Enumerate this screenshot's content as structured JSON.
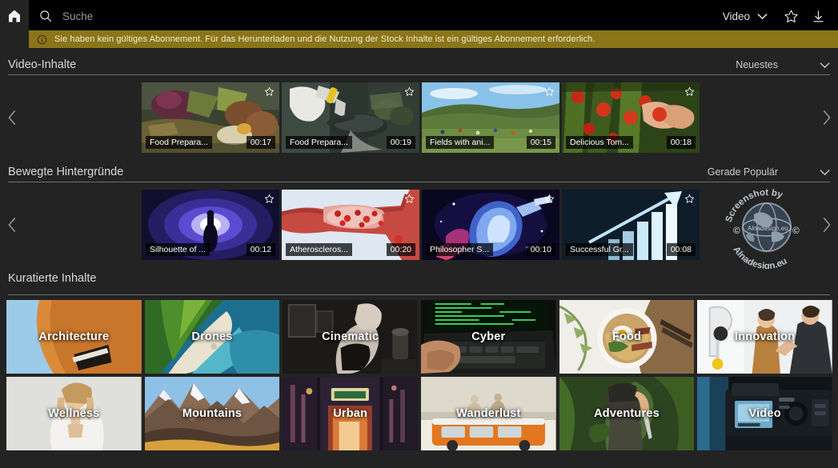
{
  "header": {
    "home_icon": "home-icon",
    "search_icon": "search-icon",
    "search_value": "",
    "search_placeholder": "Suche",
    "type_label": "Video",
    "chevron_icon": "chevron-down-icon",
    "favorites_icon": "star-icon",
    "download_icon": "download-icon"
  },
  "banner": {
    "info_icon": "info-icon",
    "text": "Sie haben kein gültiges Abonnement. Für das Herunterladen und die Nutzung der Stock Inhalte ist ein gültiges Abonnement erforderlich.",
    "color": "#8a7519"
  },
  "sections": [
    {
      "title": "Video-Inhalte",
      "sort_label": "Neuestes",
      "prev_icon": "chevron-left-icon",
      "next_icon": "chevron-right-icon",
      "items": [
        {
          "title": "Food Prepara...",
          "duration": "00:17",
          "star": true
        },
        {
          "title": "Food Prepara...",
          "duration": "00:19",
          "star": true
        },
        {
          "title": "Fields with ani...",
          "duration": "00:15",
          "star": true
        },
        {
          "title": "Delicious Tom...",
          "duration": "00:18",
          "star": true
        }
      ]
    },
    {
      "title": "Bewegte Hintergründe",
      "sort_label": "Gerade Populär",
      "prev_icon": "chevron-left-icon",
      "next_icon": "chevron-right-icon",
      "items": [
        {
          "title": "Silhouette of ...",
          "duration": "00:12",
          "star": true
        },
        {
          "title": "Atheroscleros...",
          "duration": "00:20",
          "star": true
        },
        {
          "title": "Philosopher S...",
          "duration": "00:10",
          "star": true
        },
        {
          "title": "Successful Gr...",
          "duration": "00:08",
          "star": true
        }
      ]
    }
  ],
  "curated": {
    "title": "Kuratierte Inhalte",
    "tiles": [
      {
        "label": "Architecture"
      },
      {
        "label": "Drones"
      },
      {
        "label": "Cinematic"
      },
      {
        "label": "Cyber"
      },
      {
        "label": "Food"
      },
      {
        "label": "Innovation"
      },
      {
        "label": "Wellness"
      },
      {
        "label": "Mountains"
      },
      {
        "label": "Urban"
      },
      {
        "label": "Wanderlust"
      },
      {
        "label": "Adventures"
      },
      {
        "label": "Video"
      }
    ]
  },
  "watermark": {
    "top_text": "Screenshot by",
    "bottom_text": "Alnadesign.eu",
    "globe_label": "Alnadesign.eu"
  }
}
